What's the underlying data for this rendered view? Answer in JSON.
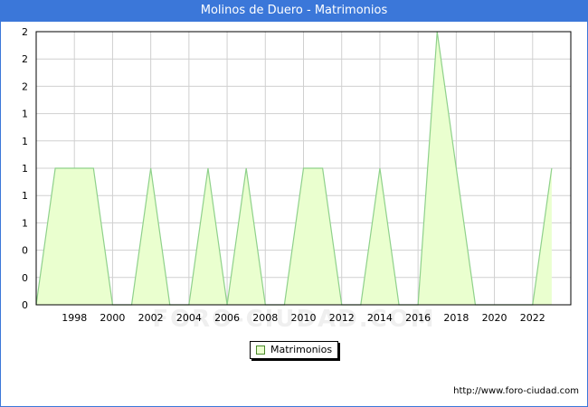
{
  "title": "Molinos de Duero - Matrimonios",
  "source": "http://www.foro-ciudad.com",
  "watermark": "FORO-CIUDAD.COM",
  "colors": {
    "header": "#3b77d9",
    "fill": "#eaffcf",
    "line": "#8fd18b",
    "grid": "#d0d0d0"
  },
  "chart_data": {
    "type": "area",
    "title": "Molinos de Duero - Matrimonios",
    "xlabel": "",
    "ylabel": "",
    "legend": "bottom-center",
    "grid": true,
    "xlim": [
      1996,
      2024
    ],
    "ylim": [
      0,
      2
    ],
    "x_ticks": [
      1998,
      2000,
      2002,
      2004,
      2006,
      2008,
      2010,
      2012,
      2014,
      2016,
      2018,
      2020,
      2022
    ],
    "y_ticks": [
      {
        "v": 0,
        "label": "0"
      },
      {
        "v": 0.2,
        "label": "0"
      },
      {
        "v": 0.4,
        "label": "0"
      },
      {
        "v": 0.6,
        "label": "1"
      },
      {
        "v": 0.8,
        "label": "1"
      },
      {
        "v": 1.0,
        "label": "1"
      },
      {
        "v": 1.2,
        "label": "1"
      },
      {
        "v": 1.4,
        "label": "1"
      },
      {
        "v": 1.6,
        "label": "2"
      },
      {
        "v": 1.8,
        "label": "2"
      },
      {
        "v": 2.0,
        "label": "2"
      }
    ],
    "series": [
      {
        "name": "Matrimonios",
        "x": [
          1996,
          1997,
          1998,
          1999,
          2000,
          2001,
          2002,
          2003,
          2004,
          2005,
          2006,
          2007,
          2008,
          2009,
          2010,
          2011,
          2012,
          2013,
          2014,
          2015,
          2016,
          2017,
          2018,
          2019,
          2020,
          2021,
          2022,
          2023
        ],
        "values": [
          0,
          1,
          1,
          1,
          0,
          0,
          1,
          0,
          0,
          1,
          0,
          1,
          0,
          0,
          1,
          1,
          0,
          0,
          1,
          0,
          0,
          2,
          1,
          0,
          0,
          0,
          0,
          1
        ]
      }
    ]
  }
}
